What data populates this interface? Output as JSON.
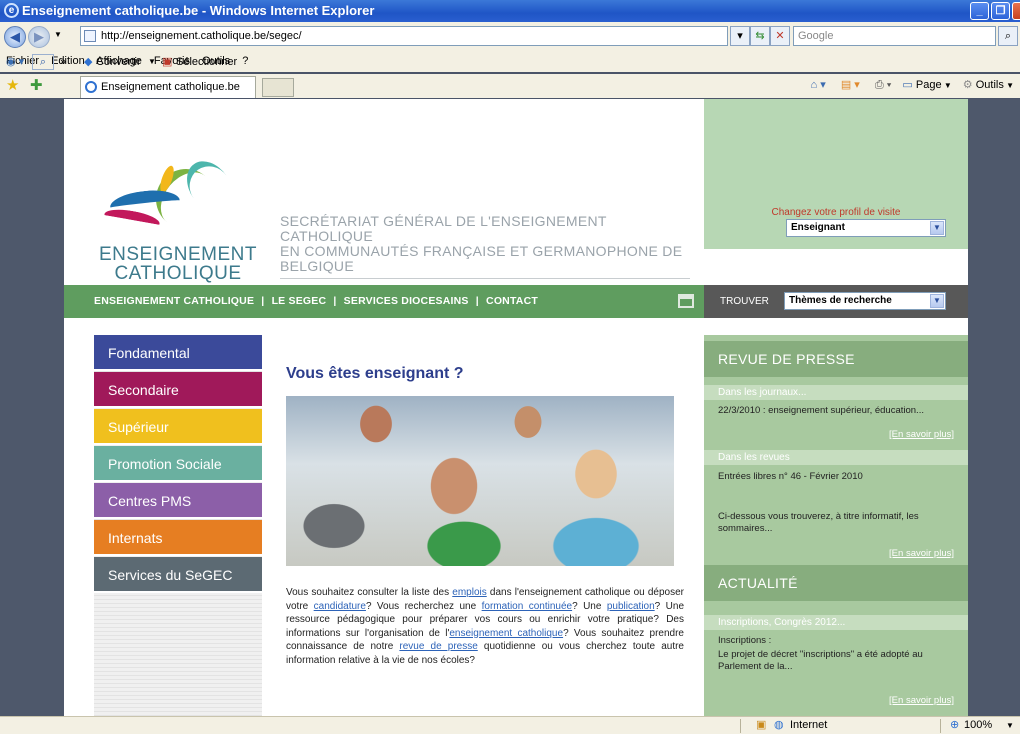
{
  "window": {
    "title": "Enseignement catholique.be - Windows Internet Explorer"
  },
  "browser": {
    "address": "http://enseignement.catholique.be/segec/",
    "search_placeholder": "Google",
    "menu": [
      "Fichier",
      "Edition",
      "Affichage",
      "Favoris",
      "Outils",
      "?"
    ],
    "links": {
      "chevron": "»",
      "convertir": "Convertir",
      "selectionner": "Sélectionner"
    },
    "tab_title": "Enseignement catholique.be",
    "commands": {
      "page": "Page",
      "outils": "Outils"
    },
    "status": {
      "zone": "Internet",
      "zoom": "100%"
    }
  },
  "site": {
    "logo_text_1": "ENSEIGNEMENT",
    "logo_text_2": "CATHOLIQUE",
    "tagline_1": "SECRÉTARIAT GÉNÉRAL DE L'ENSEIGNEMENT CATHOLIQUE",
    "tagline_2": "EN COMMUNAUTÉS FRANÇAISE ET GERMANOPHONE DE BELGIQUE",
    "profile_label": "Changez votre profil de visite",
    "profile_value": "Enseignant",
    "topnav": [
      "ENSEIGNEMENT CATHOLIQUE",
      "LE SEGEC",
      "SERVICES DIOCESAINS",
      "CONTACT"
    ],
    "topnav_sep": "|",
    "find_label": "TROUVER",
    "find_value": "Thèmes de recherche",
    "leftnav": [
      {
        "label": "Fondamental",
        "color": "#3b4a9a"
      },
      {
        "label": "Secondaire",
        "color": "#a0195a"
      },
      {
        "label": "Supérieur",
        "color": "#f0c01e"
      },
      {
        "label": "Promotion Sociale",
        "color": "#6ab0a0"
      },
      {
        "label": "Centres PMS",
        "color": "#8c5fa8"
      },
      {
        "label": "Internats",
        "color": "#e67e22"
      },
      {
        "label": "Services du SeGEC",
        "color": "#5c6a73"
      }
    ],
    "main_title": "Vous êtes enseignant ?",
    "main_text": {
      "p1": "Vous souhaitez consulter la liste des ",
      "l1": "emplois",
      "p2": " dans l'enseignement catholique ou déposer votre ",
      "l2": "candidature",
      "p3": "? Vous recherchez une ",
      "l3": "formation continuée",
      "p4": "? Une ",
      "l4": "publication",
      "p5": "? Une ressource pédagogique pour préparer vos cours ou enrichir votre pratique? Des informations sur l'organisation de l'",
      "l5": "enseignement catholique",
      "p6": "? Vous souhaitez prendre connaissance de notre ",
      "l6": "revue de presse",
      "p7": " quotidienne ou vous cherchez toute autre information relative à la vie de nos écoles?"
    },
    "right": {
      "revue_title": "REVUE DE PRESSE",
      "journaux_title": "Dans les journaux...",
      "journaux_text": "22/3/2010 : enseignement supérieur, éducation...",
      "more": "[En savoir plus]",
      "revues_title": "Dans les revues",
      "revues_text": "Entrées libres n° 46 - Février 2010",
      "revues_text2": "Ci-dessous vous trouverez, à titre informatif, les sommaires...",
      "actu_title": "ACTUALITÉ",
      "inscr_title": "Inscriptions, Congrès 2012...",
      "inscr_label": "Inscriptions :",
      "inscr_text": "Le projet de décret \"inscriptions\" a été adopté au Parlement de la..."
    }
  }
}
